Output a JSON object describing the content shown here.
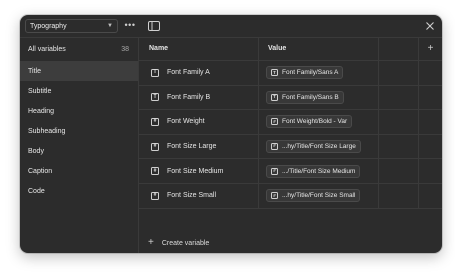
{
  "topbar": {
    "collection": "Typography",
    "more_label": "•••"
  },
  "sidebar": {
    "all_label": "All variables",
    "all_count": "38",
    "groups": [
      "Title",
      "Subtitle",
      "Heading",
      "Subheading",
      "Body",
      "Caption",
      "Code"
    ],
    "selected": "Title"
  },
  "table": {
    "headers": {
      "name": "Name",
      "value": "Value"
    },
    "rows": [
      {
        "type_icon": "text-type-icon",
        "name": "Font Family A",
        "value_icon": "text-type-icon",
        "value": "Font Family/Sans A"
      },
      {
        "type_icon": "text-type-icon",
        "name": "Font Family B",
        "value_icon": "text-type-icon",
        "value": "Font Family/Sans B"
      },
      {
        "type_icon": "number-type-icon",
        "name": "Font Weight",
        "value_icon": "number-type-icon",
        "value": "Font Weight/Bold - Var"
      },
      {
        "type_icon": "number-type-icon",
        "name": "Font Size Large",
        "value_icon": "number-type-icon",
        "value": "...hy/Title/Font Size Large"
      },
      {
        "type_icon": "number-type-icon",
        "name": "Font Size Medium",
        "value_icon": "number-type-icon",
        "value": ".../Title/Font Size Medium"
      },
      {
        "type_icon": "number-type-icon",
        "name": "Font Size Small",
        "value_icon": "number-type-icon",
        "value": "...hy/Title/Font Size Small"
      }
    ],
    "create_label": "Create variable"
  },
  "colors": {
    "window_bg": "#2c2c2c",
    "selected_bg": "#3d3d3d",
    "border": "#3a3a3a",
    "text": "#e6e6e6"
  }
}
